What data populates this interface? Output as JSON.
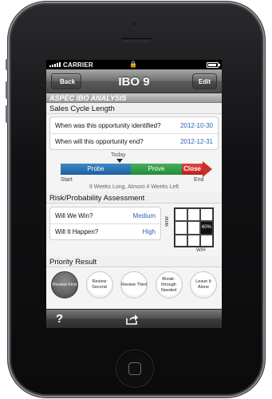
{
  "status_bar": {
    "carrier": "CARRIER"
  },
  "nav": {
    "back_label": "Back",
    "title": "IBO 9",
    "edit_label": "Edit"
  },
  "section_title": "ASPEC IBO ANALYSIS",
  "sales_cycle": {
    "header": "Sales Cycle Length",
    "rows": [
      {
        "label": "When was this opportunity identified?",
        "value": "2012-10-30"
      },
      {
        "label": "When will this opportunity end?",
        "value": "2012-12-31"
      }
    ],
    "timeline": {
      "today_label": "Today",
      "phases": [
        "Probe",
        "Prove",
        "Close"
      ],
      "start_label": "Start",
      "end_label": "End",
      "duration_text": "9 Weeks Long, Almost 4 Weeks Left"
    }
  },
  "risk": {
    "header": "Risk/Probability Assessment",
    "rows": [
      {
        "label": "Will We Win?",
        "value": "Medium"
      },
      {
        "label": "Will It Happen?",
        "value": "High"
      }
    ],
    "matrix": {
      "y_label": "WIW",
      "x_label": "WIH",
      "highlight_text": "60%"
    }
  },
  "priority": {
    "header": "Priority Result",
    "options": [
      {
        "label": "Review First",
        "active": true
      },
      {
        "label": "Review Second",
        "active": false
      },
      {
        "label": "Review Third",
        "active": false
      },
      {
        "label": "Break-through Needed",
        "active": false
      },
      {
        "label": "Leave It Alone",
        "active": false
      }
    ]
  },
  "toolbar": {
    "help_label": "?"
  },
  "icons": [
    "signal-icon",
    "lock-icon",
    "battery-icon",
    "back-arrow-icon",
    "help-icon",
    "share-icon",
    "home-button-icon"
  ]
}
